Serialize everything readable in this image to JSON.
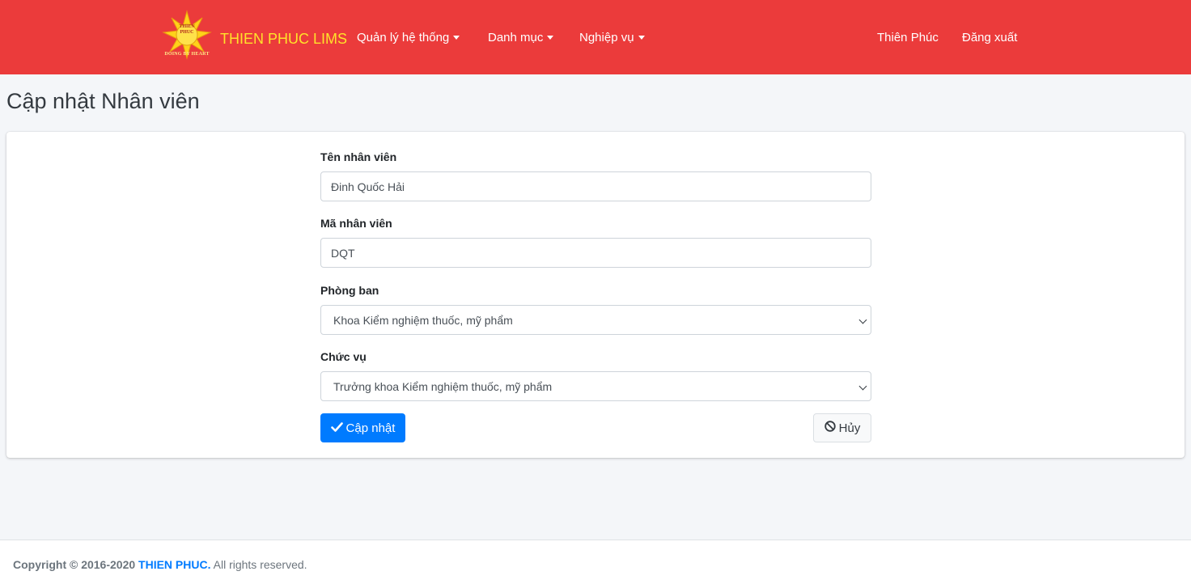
{
  "navbar": {
    "logo_text_top": "THIEN PHUC",
    "logo_text_bottom": "DOING BY HEART",
    "brand_name": "THIEN PHUC LIMS",
    "menu": [
      {
        "label": "Quản lý hệ thống"
      },
      {
        "label": "Danh mục"
      },
      {
        "label": "Nghiệp vụ"
      }
    ],
    "user_name": "Thiên Phúc",
    "logout": "Đăng xuất"
  },
  "page": {
    "title": "Cập nhật Nhân viên"
  },
  "form": {
    "name_label": "Tên nhân viên",
    "name_value": "Đinh Quốc Hải",
    "code_label": "Mã nhân viên",
    "code_value": "DQT",
    "department_label": "Phòng ban",
    "department_value": "Khoa Kiểm nghiệm thuốc, mỹ phẩm",
    "position_label": "Chức vụ",
    "position_value": "Trưởng khoa Kiểm nghiệm thuốc, mỹ phẩm",
    "update_button": "Cập nhật",
    "cancel_button": "Hủy"
  },
  "footer": {
    "copyright": "Copyright © 2016-2020",
    "company": "THIEN PHUC.",
    "rights": "All rights reserved."
  },
  "colors": {
    "navbar": "#eb3b3b",
    "brand_text": "#ffe22a",
    "primary": "#007bff"
  }
}
